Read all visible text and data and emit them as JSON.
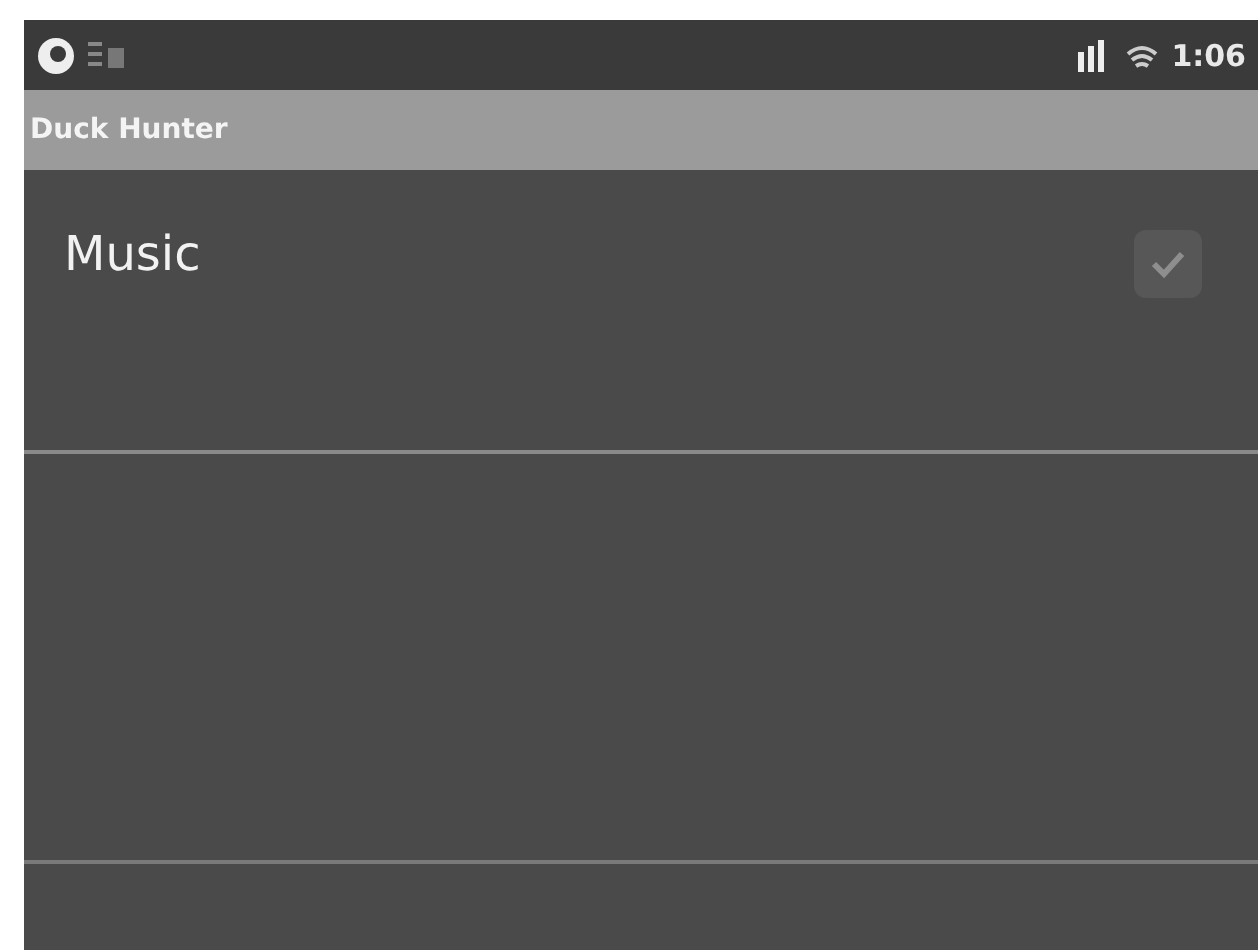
{
  "status_bar": {
    "time": "1:06"
  },
  "window": {
    "title": "Duck Hunter"
  },
  "settings": [
    {
      "label": "Music",
      "checked": true
    }
  ]
}
